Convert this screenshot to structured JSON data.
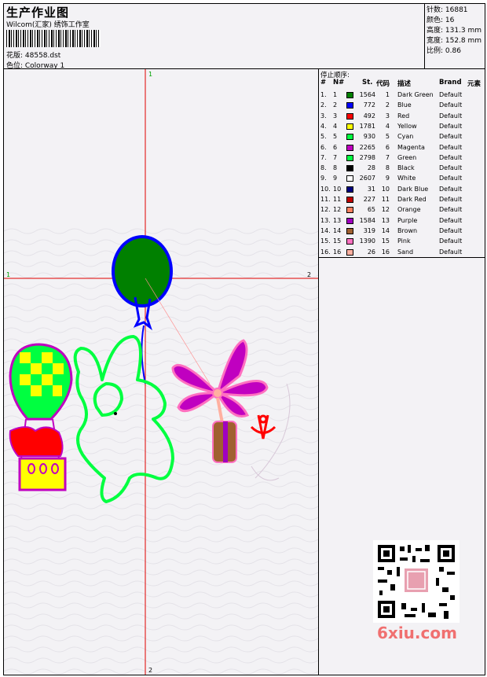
{
  "header": {
    "title": "生产作业图",
    "subtitle": "Wilcom(汇家) 绣饰工作室",
    "design_label": "花版: 48558.dst",
    "colorway_label": "色位: Colorway 1"
  },
  "stats": {
    "stitches": "针数: 16881",
    "colors": "颜色: 16",
    "height": "高度: 131.3 mm",
    "width": "宽度: 152.8 mm",
    "scale": "比例: 0.86"
  },
  "stop_sequence": {
    "title": "停止顺序:",
    "headers": {
      "hash": "#",
      "n": "N#",
      "st": "St.",
      "code": "代码",
      "desc": "描述",
      "brand": "Brand",
      "elem": "元素"
    },
    "rows": [
      {
        "hash": "1.",
        "n": "1",
        "st": "1564",
        "code": "1",
        "desc": "Dark Green",
        "brand": "Default",
        "color": "#008000"
      },
      {
        "hash": "2.",
        "n": "2",
        "st": "772",
        "code": "2",
        "desc": "Blue",
        "brand": "Default",
        "color": "#0000ff"
      },
      {
        "hash": "3.",
        "n": "3",
        "st": "492",
        "code": "3",
        "desc": "Red",
        "brand": "Default",
        "color": "#ff0000"
      },
      {
        "hash": "4.",
        "n": "4",
        "st": "1781",
        "code": "4",
        "desc": "Yellow",
        "brand": "Default",
        "color": "#ffff00"
      },
      {
        "hash": "5.",
        "n": "5",
        "st": "930",
        "code": "5",
        "desc": "Cyan",
        "brand": "Default",
        "color": "#00ff40"
      },
      {
        "hash": "6.",
        "n": "6",
        "st": "2265",
        "code": "6",
        "desc": "Magenta",
        "brand": "Default",
        "color": "#c000c0"
      },
      {
        "hash": "7.",
        "n": "7",
        "st": "2798",
        "code": "7",
        "desc": "Green",
        "brand": "Default",
        "color": "#00ff40"
      },
      {
        "hash": "8.",
        "n": "8",
        "st": "28",
        "code": "8",
        "desc": "Black",
        "brand": "Default",
        "color": "#000000"
      },
      {
        "hash": "9.",
        "n": "9",
        "st": "2607",
        "code": "9",
        "desc": "White",
        "brand": "Default",
        "color": "#ffffff"
      },
      {
        "hash": "10.",
        "n": "10",
        "st": "31",
        "code": "10",
        "desc": "Dark Blue",
        "brand": "Default",
        "color": "#000080"
      },
      {
        "hash": "11.",
        "n": "11",
        "st": "227",
        "code": "11",
        "desc": "Dark Red",
        "brand": "Default",
        "color": "#c00000"
      },
      {
        "hash": "12.",
        "n": "12",
        "st": "65",
        "code": "12",
        "desc": "Orange",
        "brand": "Default",
        "color": "#ff8060"
      },
      {
        "hash": "13.",
        "n": "13",
        "st": "1584",
        "code": "13",
        "desc": "Purple",
        "brand": "Default",
        "color": "#a000c0"
      },
      {
        "hash": "14.",
        "n": "14",
        "st": "319",
        "code": "14",
        "desc": "Brown",
        "brand": "Default",
        "color": "#a06030"
      },
      {
        "hash": "15.",
        "n": "15",
        "st": "1390",
        "code": "15",
        "desc": "Pink",
        "brand": "Default",
        "color": "#ff70c0"
      },
      {
        "hash": "16.",
        "n": "16",
        "st": "26",
        "code": "16",
        "desc": "Sand",
        "brand": "Default",
        "color": "#ffb0a0"
      }
    ]
  },
  "drawing": {
    "marker_top": "1",
    "marker_left": "1",
    "marker_right": "2",
    "marker_bottom": "2"
  },
  "watermark": "6xiu.com"
}
